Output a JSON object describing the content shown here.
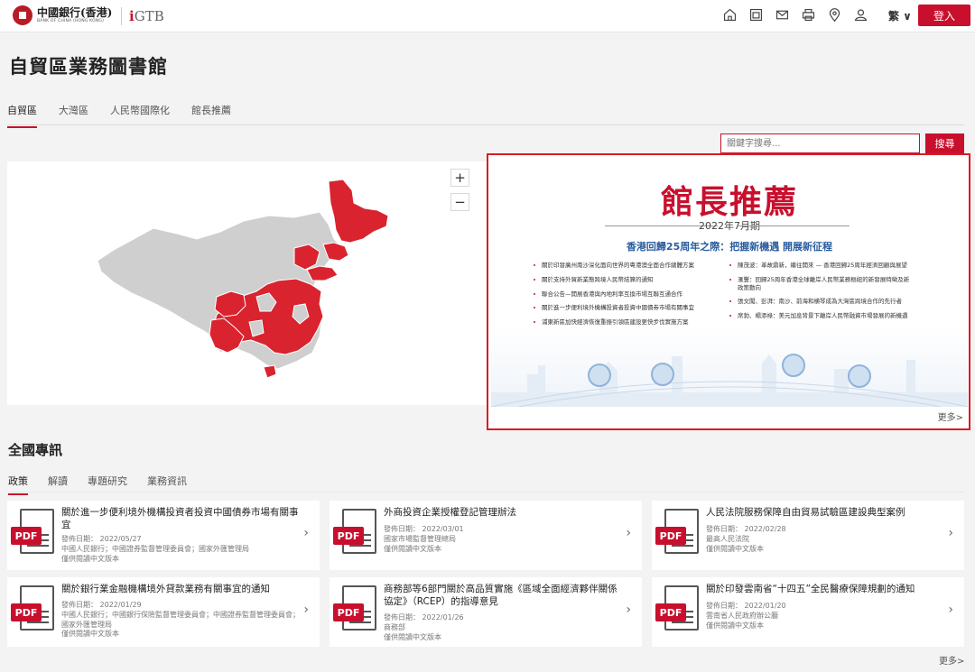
{
  "header": {
    "logo_cn": "中國銀行(香港)",
    "logo_en": "BANK OF CHINA (HONG KONG)",
    "gtb_logo": "iGTB",
    "icons": [
      "home-icon",
      "calendar-icon",
      "mail-icon",
      "print-icon",
      "location-icon",
      "user-icon"
    ],
    "lang": "繁 ∨",
    "login_label": "登入"
  },
  "page_title": "自貿區業務圖書館",
  "tabs": [
    "自貿區",
    "大灣區",
    "人民幣國際化",
    "館長推薦"
  ],
  "search": {
    "placeholder": "關鍵字搜尋...",
    "button": "搜尋"
  },
  "map": {
    "zoom_in": "+",
    "zoom_out": "−",
    "highlight_color": "#d9232e",
    "base_color": "#cfcfcf"
  },
  "banner": {
    "title": "館長推薦",
    "date": "2022年7月期",
    "subtitle": "香港回歸25周年之際：把握新機遇 開展新征程",
    "left_items": [
      "關於印發廣州南沙深化面向世界的粵港澳全面合作總體方案",
      "關於支持外貿新業態跨境人民幣結算的通知",
      "聯合公告—開展香港與內地利率互換市場互聯互通合作",
      "關於進一步便利境外機構投資者投資中國債券市場有關事宜",
      "浦東新區加快經濟恢復重振引領區建設更快步伐實施方案"
    ],
    "right_items": [
      "陳茂波：革故鼎新，繼往開來 — 香港回歸25周年經濟回顧與展望",
      "滙豐：回歸25周年香港全球離岸人民幣業務樞紐的新發展特徵及新政策動向",
      "張文闖、彭湃：南沙、前海和横琴成為大灣區跨境合作的先行者",
      "席勃、楊添祿：美元加息背景下離岸人民幣融資市場發展的新機遇"
    ],
    "more": "更多>"
  },
  "news": {
    "title": "全國專訊",
    "tabs": [
      "政策",
      "解讀",
      "專題研究",
      "業務資訊"
    ],
    "pdf_label": "PDF",
    "more": "更多>",
    "cards": [
      {
        "title": "關於進一步便利境外機構投資者投資中國債券市場有關事宜",
        "date": "發佈日期： 2022/05/27",
        "source": "中國人民銀行；中國證券監督管理委員會；國家外匯管理局",
        "lang": "僅供閱讀中文版本"
      },
      {
        "title": "外商投資企業授權登記管理辦法",
        "date": "發佈日期： 2022/03/01",
        "source": "國家市場監督管理總局",
        "lang": "僅供閱讀中文版本"
      },
      {
        "title": "人民法院服務保障自由貿易試驗區建設典型案例",
        "date": "發佈日期： 2022/02/28",
        "source": "最高人民法院",
        "lang": "僅供閱讀中文版本"
      },
      {
        "title": "關於銀行業金融機構境外貸款業務有關事宜的通知",
        "date": "發佈日期： 2022/01/29",
        "source": "中國人民銀行；中國銀行保險監督管理委員會；中國證券監督管理委員會；國家外匯管理局",
        "lang": "僅供閱讀中文版本"
      },
      {
        "title": "商務部等6部門關於高品質實施《區域全面經濟夥伴關係協定》（RCEP）的指導意見",
        "date": "發佈日期： 2022/01/26",
        "source": "商務部",
        "lang": "僅供閱讀中文版本"
      },
      {
        "title": "關於印發雲南省“十四五”全民醫療保障規劃的通知",
        "date": "發佈日期： 2022/01/20",
        "source": "雲南省人民政府辦公廳",
        "lang": "僅供閱讀中文版本"
      }
    ]
  }
}
